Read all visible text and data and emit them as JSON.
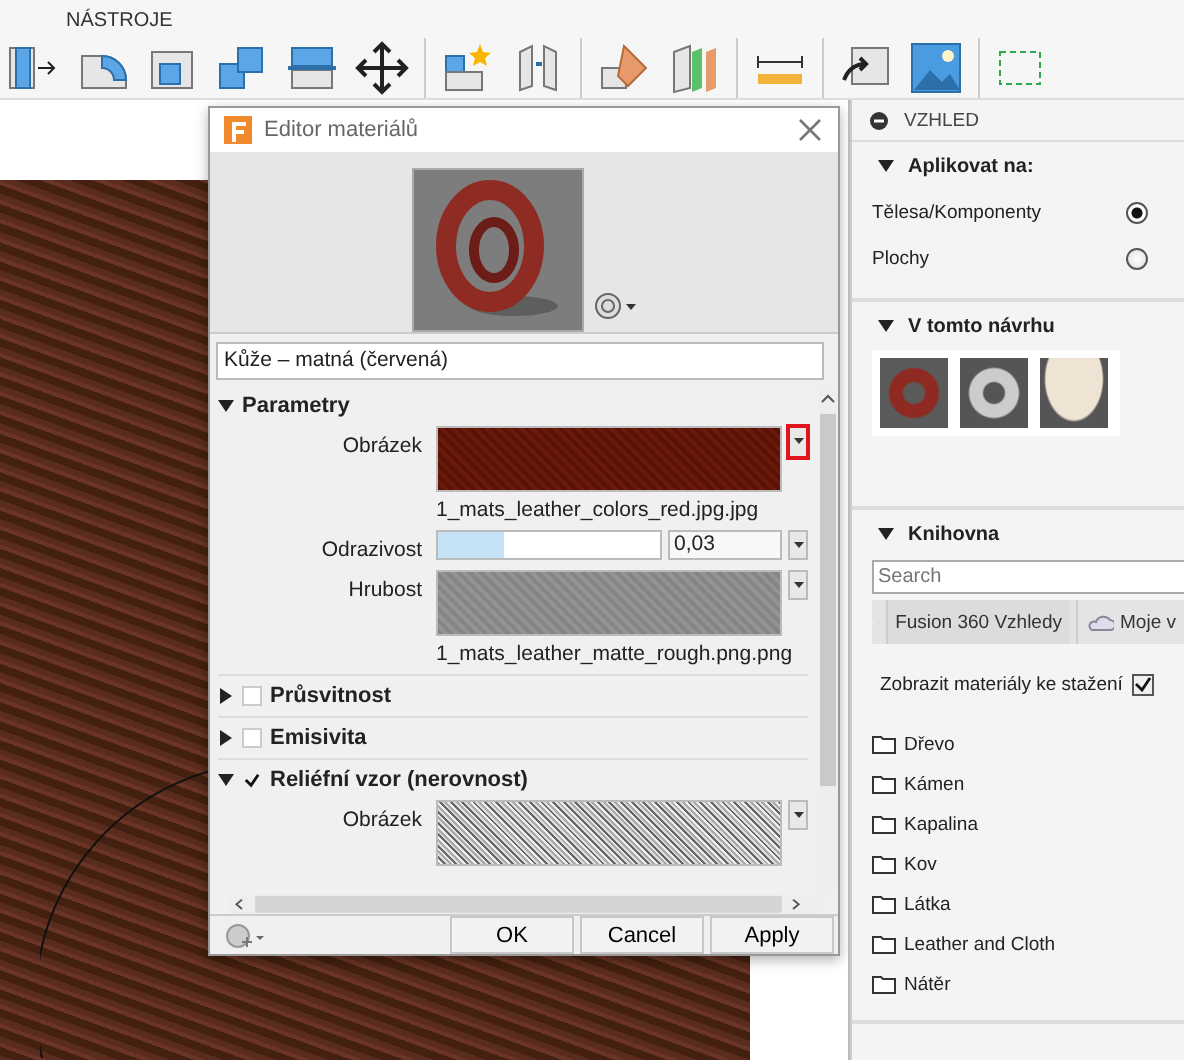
{
  "toolbar": {
    "section_label": "NÁSTROJE"
  },
  "dialog": {
    "title": "Editor materiálů",
    "material_name": "Kůže – matná (červená)",
    "sections": [
      {
        "title": "Parametry",
        "expanded": true,
        "kind": "plain",
        "rows": [
          {
            "kind": "image",
            "label": "Obrázek",
            "filename": "1_mats_leather_colors_red.jpg.jpg",
            "highlighted": true
          },
          {
            "kind": "slider",
            "label": "Odrazivost",
            "level": 0.3,
            "value": "0,03"
          },
          {
            "kind": "image",
            "label": "Hrubost",
            "filename": "1_mats_leather_matte_rough.png.png",
            "highlighted": false
          }
        ]
      },
      {
        "title": "Průsvitnost",
        "expanded": false,
        "kind": "checkbox",
        "checked": false
      },
      {
        "title": "Emisivita",
        "expanded": false,
        "kind": "checkbox",
        "checked": false
      },
      {
        "title": "Reliéfní vzor (nerovnost)",
        "expanded": true,
        "kind": "checkbox",
        "checked": true,
        "rows": [
          {
            "kind": "image",
            "label": "Obrázek",
            "highlighted": false
          }
        ]
      }
    ],
    "buttons": [
      "OK",
      "Cancel",
      "Apply"
    ]
  },
  "panel": {
    "title": "VZHLED",
    "apply_to": {
      "title": "Aplikovat na:",
      "expanded": true,
      "options": [
        {
          "label": "Tělesa/Komponenty",
          "selected": true
        },
        {
          "label": "Plochy",
          "selected": false
        }
      ]
    },
    "in_design": {
      "title": "V tomto návrhu",
      "expanded": true
    },
    "library": {
      "title": "Knihovna",
      "expanded": true,
      "search": {
        "placeholder": "Search"
      },
      "tabs": [
        {
          "label": "Fusion 360 Vzhledy",
          "selected": true
        },
        {
          "label": "Moje v",
          "selected": false
        }
      ],
      "show_downloadable": {
        "label": "Zobrazit materiály ke stažení",
        "checked": true
      },
      "folders": [
        "Dřevo",
        "Kámen",
        "Kapalina",
        "Kov",
        "Látka",
        "Leather and Cloth",
        "Nátěr"
      ]
    }
  }
}
